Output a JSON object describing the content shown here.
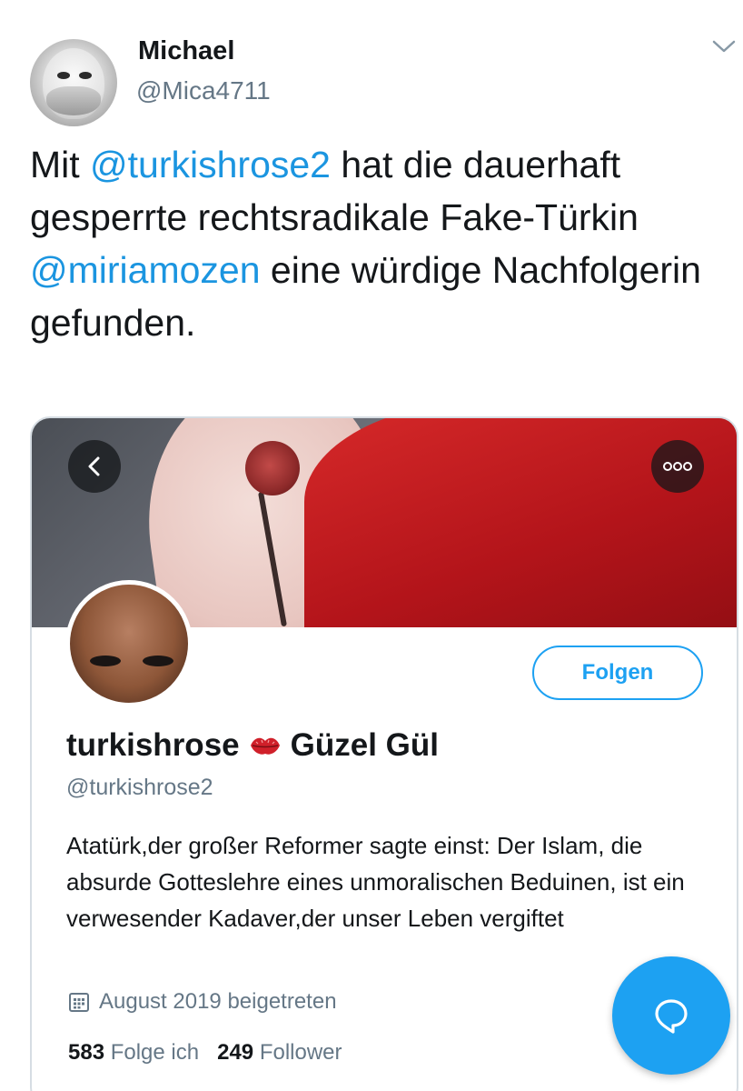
{
  "tweet": {
    "author_name": "Michael",
    "author_handle": "@Mica4711",
    "text_part1": "Mit ",
    "mention1": "@turkishrose2",
    "text_part2": " hat die dauerhaft gesperrte rechtsradikale Fake-Türkin ",
    "mention2": "@miriamozen",
    "text_part3": " eine würdige Nachfolgerin gefunden.",
    "mention_color": "#1b95e0"
  },
  "card": {
    "follow_label": "Folgen",
    "display_name": "turkishrose",
    "display_name_suffix": "Güzel Gül",
    "handle": "@turkishrose2",
    "bio": "Atatürk,der großer Reformer sagte einst: Der Islam, die absurde Gotteslehre eines unmoralischen Beduinen, ist ein verwesender Kadaver,der unser Leben vergiftet",
    "joined": "August 2019 beigetreten",
    "following_count": "583",
    "following_label": "Folge ich",
    "followers_count": "249",
    "followers_label": "Follower"
  },
  "colors": {
    "accent": "#1da1f2",
    "text_primary": "#14171a",
    "text_secondary": "#657786"
  },
  "icons": [
    "chevron-down-icon",
    "back-arrow-icon",
    "more-icon",
    "kiss-lips-icon",
    "calendar-icon",
    "compose-chat-icon"
  ]
}
